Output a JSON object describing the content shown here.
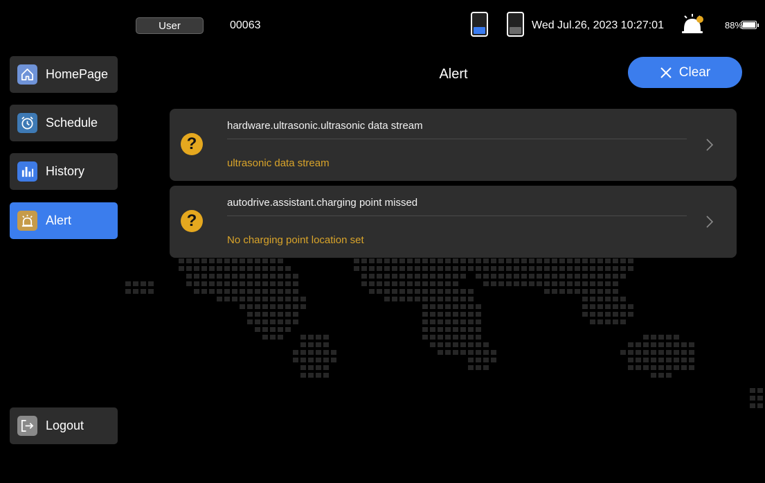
{
  "status_bar": {
    "user_label": "User",
    "device_id": "00063",
    "datetime": "Wed Jul.26, 2023 10:27:01",
    "battery_percent": "88%",
    "battery_level": 0.88,
    "battery1_level": 0.3,
    "battery2_level": 0.3
  },
  "sidebar": {
    "items": [
      {
        "label": "HomePage",
        "icon": "home-icon"
      },
      {
        "label": "Schedule",
        "icon": "clock-icon"
      },
      {
        "label": "History",
        "icon": "bar-chart-icon"
      },
      {
        "label": "Alert",
        "icon": "alarm-icon",
        "active": true
      }
    ],
    "logout_label": "Logout"
  },
  "header": {
    "title": "Alert",
    "clear_label": "Clear"
  },
  "alerts": [
    {
      "title": "hardware.ultrasonic.ultrasonic data stream",
      "description": "ultrasonic data stream",
      "icon": "question-icon"
    },
    {
      "title": "autodrive.assistant.charging point missed",
      "description": "No charging point location set",
      "icon": "question-icon"
    }
  ],
  "colors": {
    "accent": "#3b7ded",
    "warning": "#e5a81f",
    "card_bg": "#2e2e2e",
    "background": "#000000"
  }
}
